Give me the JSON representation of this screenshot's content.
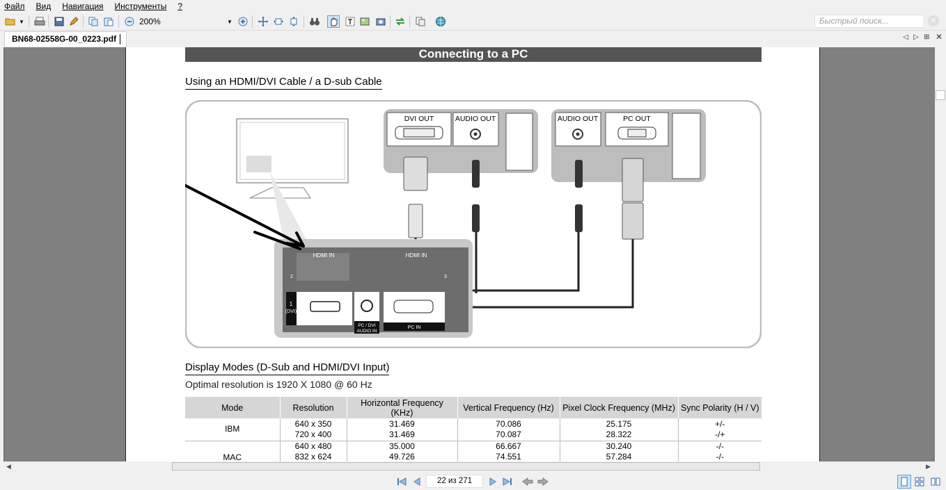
{
  "menu": [
    "Файл",
    "Вид",
    "Навигация",
    "Инструменты",
    "?"
  ],
  "toolbar": {
    "zoom_value": "200%",
    "search_placeholder": "Быстрый поиск..."
  },
  "tab": {
    "title": "BN68-02558G-00_0223.pdf"
  },
  "page": {
    "section_title": "Connecting to a PC",
    "subsection_1": "Using an HDMI/DVI Cable / a D-sub Cable",
    "diagram": {
      "dvi_out": "DVI OUT",
      "audio_out_1": "AUDIO OUT",
      "audio_out_2": "AUDIO OUT",
      "pc_out": "PC OUT",
      "hdmi_in_1": "HDMI IN",
      "hdmi_in_2": "HDMI IN",
      "port_1_label": "1",
      "port_1_sub": "(DVI)",
      "port_2": "2",
      "port_3": "3",
      "pc_dvi_audio_in_1": "PC / DVI",
      "pc_dvi_audio_in_2": "AUDIO IN",
      "pc_in": "PC IN"
    },
    "subsection_2": "Display Modes (D-Sub and HDMI/DVI Input)",
    "optimal_resolution": "Optimal resolution is 1920 X 1080 @ 60 Hz",
    "table": {
      "headers": [
        "Mode",
        "Resolution",
        "Horizontal Frequency (KHz)",
        "Vertical Frequency (Hz)",
        "Pixel Clock Frequency (MHz)",
        "Sync Polarity (H / V)"
      ],
      "rows": [
        {
          "mode": "IBM",
          "resolution": [
            "640 x 350",
            "720 x 400"
          ],
          "hfreq": [
            "31.469",
            "31.469"
          ],
          "vfreq": [
            "70.086",
            "70.087"
          ],
          "pclk": [
            "25.175",
            "28.322"
          ],
          "sync": [
            "+/-",
            "-/+"
          ]
        },
        {
          "mode": "MAC",
          "resolution": [
            "640 x 480",
            "832 x 624"
          ],
          "hfreq": [
            "35.000",
            "49.726"
          ],
          "vfreq": [
            "66.667",
            "74.551"
          ],
          "pclk": [
            "30.240",
            "57.284"
          ],
          "sync": [
            "-/-",
            "-/-"
          ]
        }
      ]
    }
  },
  "status": {
    "page_indicator": "22 из 271"
  },
  "colors": {
    "viewer_bg": "#808080",
    "section_bar": "#555555",
    "table_header": "#d6d6d6",
    "active_view": "#cde3f7"
  },
  "icons": [
    "open-icon",
    "print-icon",
    "save-icon",
    "edit-icon",
    "copy-icon",
    "paste-icon",
    "zoom-out-icon",
    "zoom-in-icon",
    "fit-page-icon",
    "fit-width-icon",
    "fit-height-icon",
    "binoculars-icon",
    "hand-icon",
    "select-text-icon",
    "select-image-icon",
    "snapshot-icon",
    "rotate-icon",
    "duplicate-icon",
    "globe-icon"
  ]
}
